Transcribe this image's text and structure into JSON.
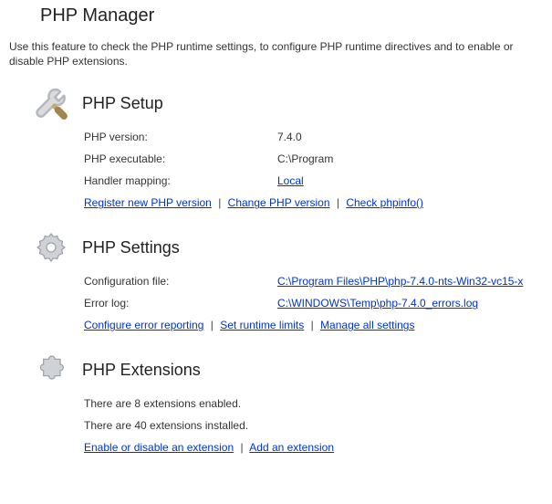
{
  "header": {
    "title": "PHP Manager",
    "intro": "Use this feature to check the PHP runtime settings, to configure PHP runtime directives and to enable or disable PHP extensions."
  },
  "setup": {
    "title": "PHP Setup",
    "rows": {
      "version_label": "PHP version:",
      "version_value": "7.4.0",
      "exe_label": "PHP executable:",
      "exe_value": "C:\\Program",
      "handler_label": "Handler mapping:",
      "handler_value": "Local"
    },
    "links": {
      "register": "Register new PHP version",
      "change": "Change PHP version",
      "phpinfo": "Check phpinfo()"
    }
  },
  "settings": {
    "title": "PHP Settings",
    "rows": {
      "config_label": "Configuration file:",
      "config_value": "C:\\Program Files\\PHP\\php-7.4.0-nts-Win32-vc15-x",
      "errorlog_label": "Error log:",
      "errorlog_value": "C:\\WINDOWS\\Temp\\php-7.4.0_errors.log"
    },
    "links": {
      "errreport": "Configure error reporting",
      "runtime": "Set runtime limits",
      "manageall": "Manage all settings"
    }
  },
  "extensions": {
    "title": "PHP Extensions",
    "enabled_line": "There are 8 extensions enabled.",
    "installed_line": "There are 40 extensions installed.",
    "links": {
      "enabledisable": "Enable or disable an extension",
      "add": "Add an extension"
    }
  }
}
